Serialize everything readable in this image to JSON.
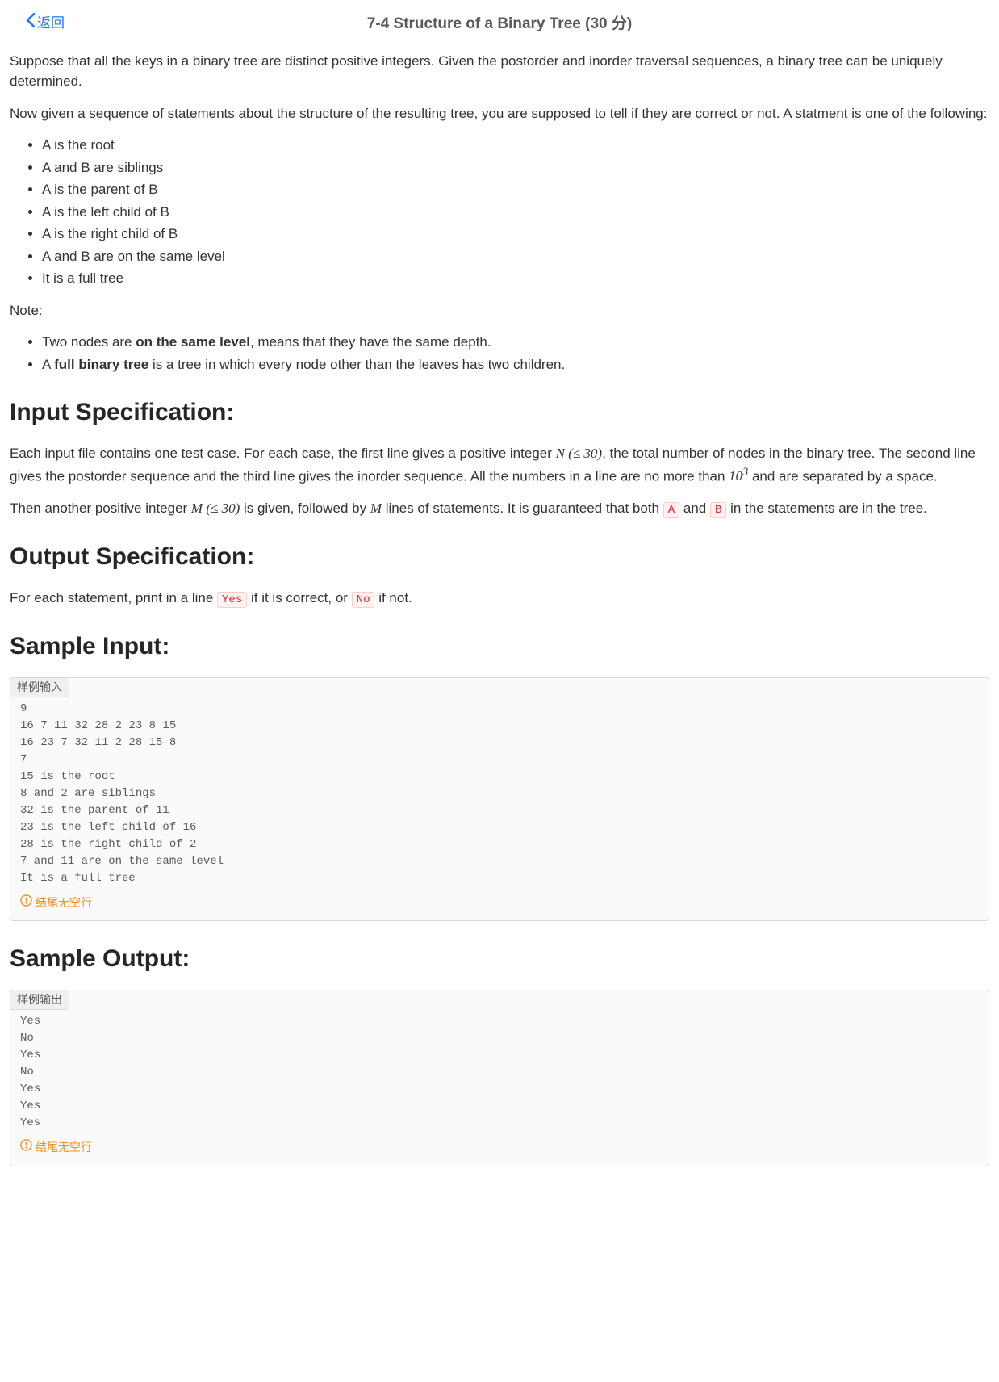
{
  "header": {
    "back_label": "返回",
    "title": "7-4 Structure of a Binary Tree (30 分)"
  },
  "intro": {
    "p1": "Suppose that all the keys in a binary tree are distinct positive integers. Given the postorder and inorder traversal sequences, a binary tree can be uniquely determined.",
    "p2": "Now given a sequence of statements about the structure of the resulting tree, you are supposed to tell if they are correct or not. A statment is one of the following:",
    "stmts": [
      "A is the root",
      "A and B are siblings",
      "A is the parent of B",
      "A is the left child of B",
      "A is the right child of B",
      "A and B are on the same level",
      "It is a full tree"
    ],
    "note_label": "Note:",
    "note1_a": "Two nodes are ",
    "note1_b": "on the same level",
    "note1_c": ", means that they have the same depth.",
    "note2_a": "A ",
    "note2_b": "full binary tree",
    "note2_c": " is a tree in which every node other than the leaves has two children."
  },
  "input_spec": {
    "heading": "Input Specification:",
    "p1_a": "Each input file contains one test case. For each case, the first line gives a positive integer ",
    "p1_N": "N",
    "p1_le30": " (≤ 30)",
    "p1_b": ", the total number of nodes in the binary tree. The second line gives the postorder sequence and the third line gives the inorder sequence. All the numbers in a line are no more than ",
    "p1_103_base": "10",
    "p1_103_sup": "3",
    "p1_c": " and are separated by a space.",
    "p2_a": "Then another positive integer ",
    "p2_M": "M",
    "p2_le30": " (≤ 30)",
    "p2_b": " is given, followed by ",
    "p2_M2": "M",
    "p2_c": " lines of statements. It is guaranteed that both ",
    "p2_A": "A",
    "p2_and": " and ",
    "p2_B": "B",
    "p2_d": " in the statements are in the tree."
  },
  "output_spec": {
    "heading": "Output Specification:",
    "p_a": "For each statement, print in a line ",
    "yes": "Yes",
    "p_b": " if it is correct, or ",
    "no": "No",
    "p_c": " if not."
  },
  "sample_input": {
    "heading": "Sample Input:",
    "label": "样例输入",
    "text": "9\n16 7 11 32 28 2 23 8 15\n16 23 7 32 11 2 28 15 8\n7\n15 is the root\n8 and 2 are siblings\n32 is the parent of 11\n23 is the left child of 16\n28 is the right child of 2\n7 and 11 are on the same level\nIt is a full tree",
    "no_blank": "结尾无空行"
  },
  "sample_output": {
    "heading": "Sample Output:",
    "label": "样例输出",
    "text": "Yes\nNo\nYes\nNo\nYes\nYes\nYes",
    "no_blank": "结尾无空行"
  }
}
